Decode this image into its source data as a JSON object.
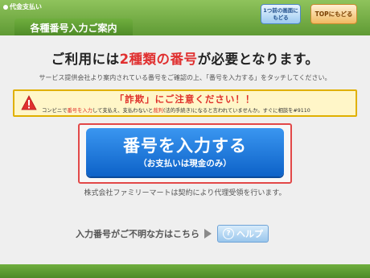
{
  "header": {
    "service_label": "代金支払い",
    "title": "各種番号入力ご案内",
    "back_label_line1": "1つ前の画面に",
    "back_label_line2": "もどる",
    "top_label": "TOPにもどる"
  },
  "main": {
    "headline_pre": "ご利用には",
    "headline_highlight": "2種類の番号",
    "headline_post": "が必要となります。",
    "subtext": "サービス提供会社より案内されている番号をご確認の上、「番号を入力する」をタッチしてください。"
  },
  "warning": {
    "title": "「詐欺」にご注意ください！！",
    "body_1": "コンビニで",
    "body_red_1": "番号を入力",
    "body_2": "して支払え、支払わないと",
    "body_red_2": "裁判",
    "body_3": "(法的手続き)になると言われていませんか。すぐに相談を#9110"
  },
  "input_button": {
    "main_label": "番号を入力する",
    "sub_label": "（お支払いは現金のみ）"
  },
  "notice": "株式会社ファミリーマートは契約により代理受領を行います。",
  "help": {
    "text": "入力番号がご不明な方はこちら",
    "button_label": "ヘルプ",
    "q_mark": "?"
  },
  "colors": {
    "header_green": "#6fae3e",
    "accent_red": "#e03030",
    "button_blue": "#1d7ae0"
  }
}
